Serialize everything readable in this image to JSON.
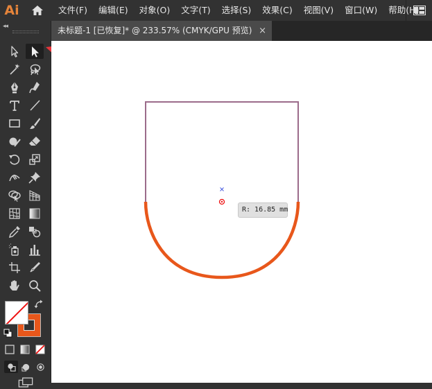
{
  "app": {
    "logo": "Ai"
  },
  "menu": [
    "文件(F)",
    "编辑(E)",
    "对象(O)",
    "文字(T)",
    "选择(S)",
    "效果(C)",
    "视图(V)",
    "窗口(W)",
    "帮助(H)"
  ],
  "tab": {
    "title": "未标题-1 [已恢复]* @ 233.57% (CMYK/GPU 预览)",
    "close": "×"
  },
  "canvas": {
    "radius_label": "R: 16.85 mm"
  },
  "colors": {
    "accent": "#e5843a",
    "stroke": "#e8571b",
    "path": "#9b6b8a",
    "arrow": "#e8353b"
  },
  "toolbar": {
    "collapse": "◂◂"
  }
}
